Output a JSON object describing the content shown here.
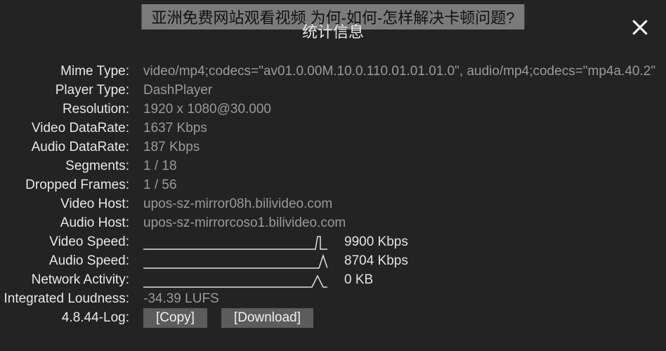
{
  "banner_text": "亚洲免费网站观看视频  为何-如何-怎样解决卡顿问题?",
  "panel_title": "统计信息",
  "labels": {
    "mime_type": "Mime Type:",
    "player_type": "Player Type:",
    "resolution": "Resolution:",
    "video_datarate": "Video DataRate:",
    "audio_datarate": "Audio DataRate:",
    "segments": "Segments:",
    "dropped_frames": "Dropped Frames:",
    "video_host": "Video Host:",
    "audio_host": "Audio Host:",
    "video_speed": "Video Speed:",
    "audio_speed": "Audio Speed:",
    "network_activity": "Network Activity:",
    "integrated_loudness": "Integrated Loudness:",
    "log": "4.8.44-Log:"
  },
  "values": {
    "mime_type": "video/mp4;codecs=\"av01.0.00M.10.0.110.01.01.01.0\", audio/mp4;codecs=\"mp4a.40.2\"",
    "player_type": "DashPlayer",
    "resolution": "1920 x 1080@30.000",
    "video_datarate": "1637 Kbps",
    "audio_datarate": "187 Kbps",
    "segments": "1 / 18",
    "dropped_frames": "1 / 56",
    "video_host": "upos-sz-mirror08h.bilivideo.com",
    "audio_host": "upos-sz-mirrorcoso1.bilivideo.com",
    "video_speed": "9900 Kbps",
    "audio_speed": "8704 Kbps",
    "network_activity": "0 KB",
    "integrated_loudness": "-34.39 LUFS"
  },
  "buttons": {
    "copy": "[Copy]",
    "download": "[Download]"
  }
}
